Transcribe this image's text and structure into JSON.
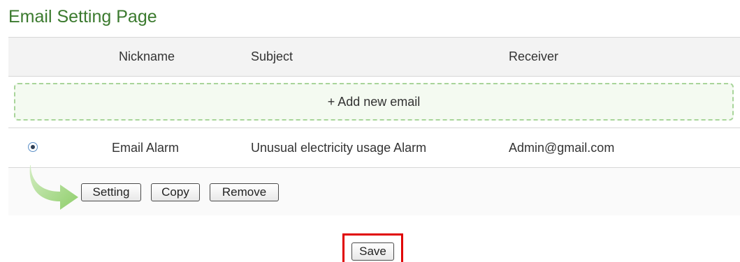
{
  "page": {
    "title": "Email Setting Page"
  },
  "table": {
    "headers": {
      "nickname": "Nickname",
      "subject": "Subject",
      "receiver": "Receiver"
    },
    "add_new_label": "+ Add new email",
    "rows": [
      {
        "selected": true,
        "nickname": "Email Alarm",
        "subject": "Unusual electricity usage Alarm",
        "receiver": "Admin@gmail.com"
      }
    ]
  },
  "actions": {
    "setting_label": "Setting",
    "copy_label": "Copy",
    "remove_label": "Remove",
    "arrow_icon": "curved-arrow-right-icon"
  },
  "footer": {
    "save_label": "Save",
    "highlight_color": "#e00000"
  },
  "colors": {
    "title": "#3b7a2e",
    "add_border": "#a8d59a",
    "add_background": "#f4faf1",
    "header_background": "#f3f3f3",
    "arrow": "#8fce6b"
  }
}
